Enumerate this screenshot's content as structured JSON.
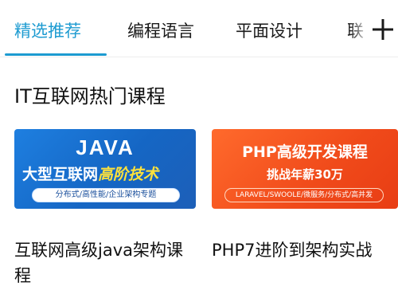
{
  "tabs": [
    {
      "label": "精选推荐",
      "active": true
    },
    {
      "label": "编程语言",
      "active": false
    },
    {
      "label": "平面设计",
      "active": false
    },
    {
      "label": "联",
      "active": false
    }
  ],
  "icons": {
    "plus": "plus-icon"
  },
  "colors": {
    "accent": "#1d9bd1",
    "java_banner": "#1e7fe0",
    "php_banner": "#f04a1a"
  },
  "section": {
    "title": "IT互联网热门课程"
  },
  "courses": [
    {
      "name": "互联网高级java架构课程",
      "banner": {
        "title": "JAVA",
        "subtitle_main": "大型互联网",
        "subtitle_accent": "高阶技术",
        "tags": "分布式/高性能/企业架构专题"
      }
    },
    {
      "name": "PHP7进阶到架构实战",
      "banner": {
        "title": "PHP高级开发课程",
        "subtitle": "挑战年薪30万",
        "tags": "LARAVEL/SWOOLE/微服务/分布式/高并发"
      }
    }
  ]
}
